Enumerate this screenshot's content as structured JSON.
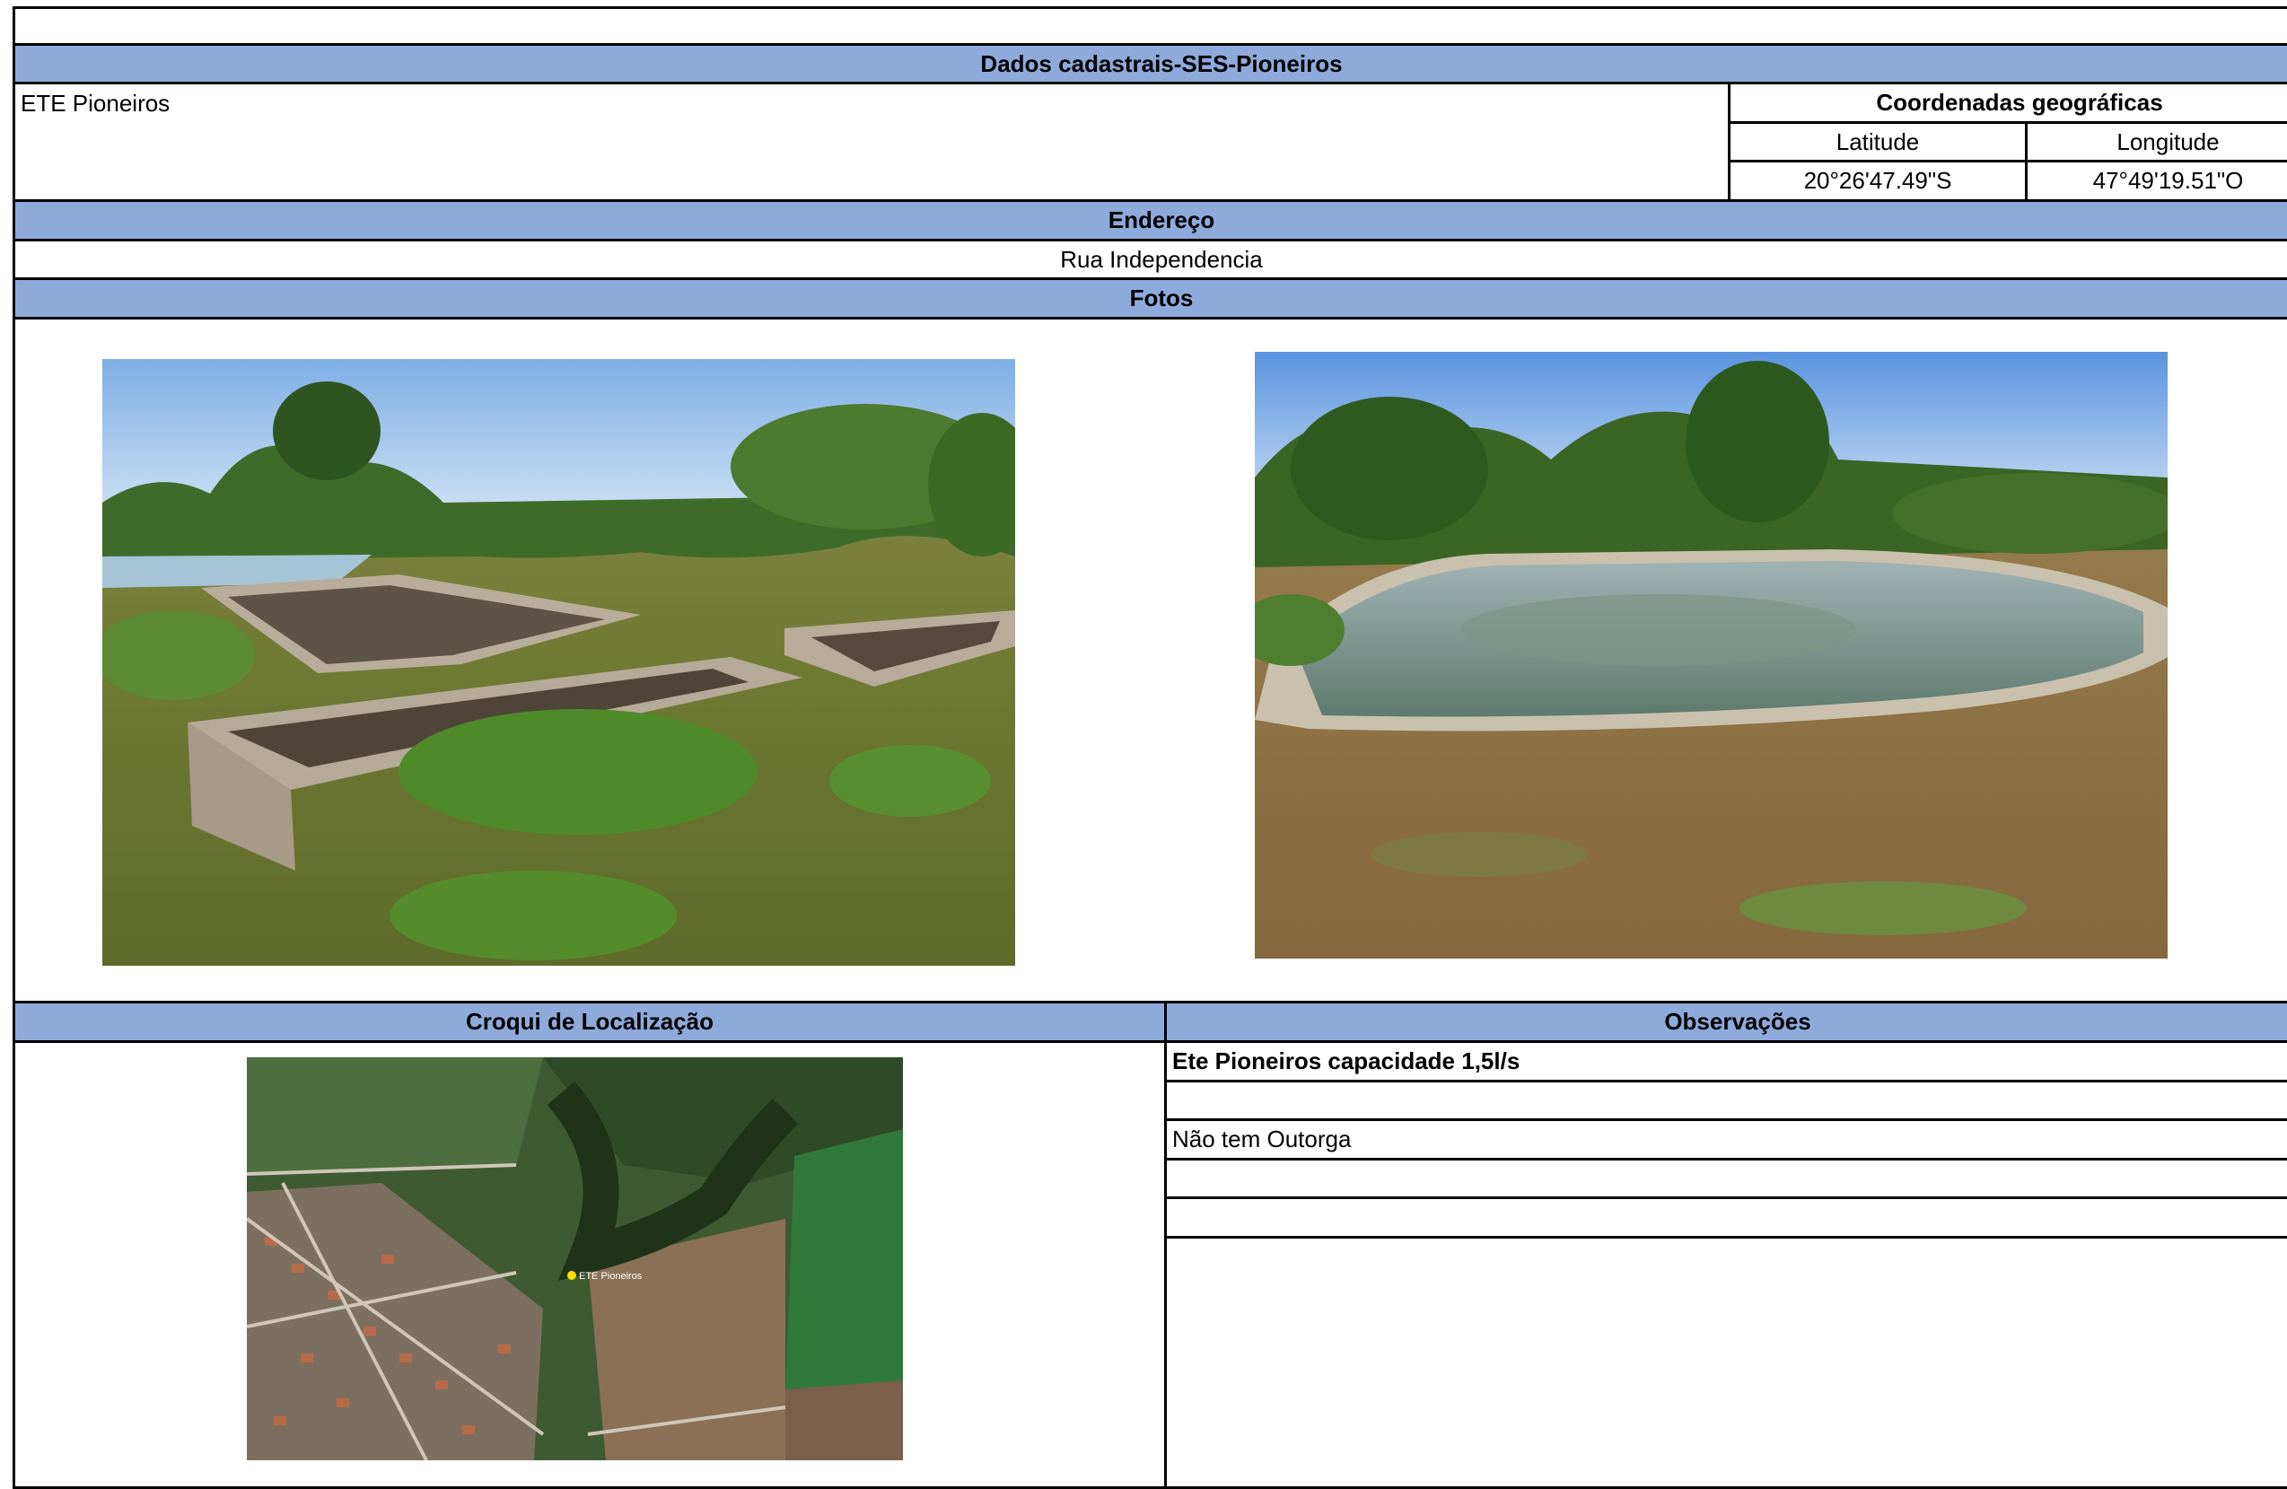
{
  "header": {
    "title": "Dados cadastrais-SES-Pioneiros"
  },
  "station": {
    "name": "ETE Pioneiros"
  },
  "coords": {
    "title": "Coordenadas geográficas",
    "lat_label": "Latitude",
    "lon_label": "Longitude",
    "lat_value": "20°26'47.49\"S",
    "lon_value": "47°49'19.51\"O"
  },
  "address": {
    "title": "Endereço",
    "value": "Rua Independencia"
  },
  "photos": {
    "title": "Fotos",
    "items": [
      {
        "icon": "photo-treatment-tanks"
      },
      {
        "icon": "photo-stabilization-pond"
      }
    ]
  },
  "croqui": {
    "title": "Croqui de Localização",
    "map_label": "ETE Pioneiros"
  },
  "observations": {
    "title": "Observações",
    "lines": [
      "Ete Pioneiros capacidade 1,5l/s",
      "",
      "Não tem Outorga",
      "",
      ""
    ]
  },
  "colors": {
    "header_fill": "#8eaadb",
    "border": "#000000"
  }
}
